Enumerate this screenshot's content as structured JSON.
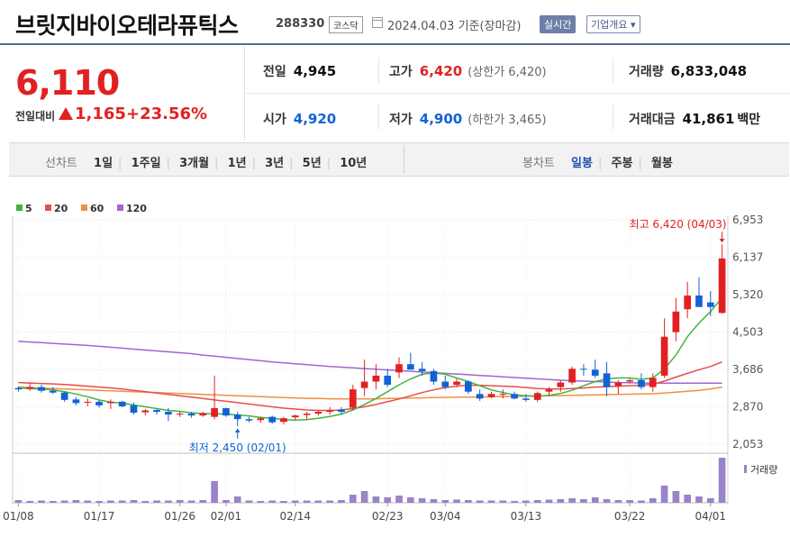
{
  "header": {
    "name": "브릿지바이오테라퓨틱스",
    "code": "288330",
    "market": "코스닥",
    "as_of": "2024.04.03 기준(장마감)",
    "realtime_btn": "실시간",
    "company_btn": "기업개요 ▾"
  },
  "quote": {
    "price": "6,110",
    "change_label": "전일대비",
    "change": "1,165",
    "change_pct": "+23.56%",
    "prev_close_label": "전일",
    "prev_close": "4,945",
    "high_label": "고가",
    "high": "6,420",
    "upper_limit": "(상한가 6,420)",
    "volume_label": "거래량",
    "volume": "6,833,048",
    "open_label": "시가",
    "open": "4,920",
    "low_label": "저가",
    "low": "4,900",
    "lower_limit": "(하한가 3,465)",
    "amount_label": "거래대금",
    "amount": "41,861",
    "amount_unit": "백만"
  },
  "toolbar": {
    "line_chart_label": "선차트",
    "periods": [
      "1일",
      "1주일",
      "3개월",
      "1년",
      "3년",
      "5년",
      "10년"
    ],
    "candle_label": "봉차트",
    "candle_periods": [
      "일봉",
      "주봉",
      "월봉"
    ],
    "active_candle": 0
  },
  "colors": {
    "up": "#e12121",
    "down": "#1262d6",
    "ma5": "#3fb53f",
    "ma20": "#e84c4c",
    "ma60": "#f09040",
    "ma120": "#a066d0",
    "volume": "#9a83c8"
  },
  "chart_data": {
    "type": "candlestick",
    "legend": [
      "5",
      "20",
      "60",
      "120"
    ],
    "y_ticks": [
      2053,
      2870,
      3686,
      4503,
      5320,
      6137,
      6953
    ],
    "ylim": [
      2053,
      6953
    ],
    "x_labels": [
      {
        "label": "01/08",
        "index": 0
      },
      {
        "label": "01/17",
        "index": 7
      },
      {
        "label": "01/26",
        "index": 14
      },
      {
        "label": "02/01",
        "index": 18
      },
      {
        "label": "02/14",
        "index": 24
      },
      {
        "label": "02/23",
        "index": 32
      },
      {
        "label": "03/04",
        "index": 37
      },
      {
        "label": "03/13",
        "index": 44
      },
      {
        "label": "03/22",
        "index": 53
      },
      {
        "label": "04/01",
        "index": 60
      }
    ],
    "max_annotation": "최고 6,420 (04/03)",
    "min_annotation": "최저 2,450 (02/01)",
    "volume_label": "거래량",
    "candles": [
      [
        3280,
        3320,
        3200,
        3250
      ],
      [
        3260,
        3400,
        3220,
        3300
      ],
      [
        3300,
        3350,
        3180,
        3220
      ],
      [
        3220,
        3300,
        3150,
        3180
      ],
      [
        3180,
        3200,
        2980,
        3020
      ],
      [
        3030,
        3080,
        2900,
        2950
      ],
      [
        2960,
        3050,
        2880,
        2980
      ],
      [
        2980,
        3020,
        2850,
        2900
      ],
      [
        2950,
        3030,
        2820,
        2980
      ],
      [
        2980,
        3000,
        2860,
        2880
      ],
      [
        2900,
        2960,
        2700,
        2740
      ],
      [
        2750,
        2820,
        2680,
        2790
      ],
      [
        2800,
        2830,
        2700,
        2760
      ],
      [
        2760,
        2840,
        2560,
        2700
      ],
      [
        2700,
        2760,
        2650,
        2720
      ],
      [
        2720,
        2760,
        2630,
        2680
      ],
      [
        2680,
        2760,
        2650,
        2730
      ],
      [
        2650,
        3550,
        2600,
        2840
      ],
      [
        2840,
        2850,
        2650,
        2680
      ],
      [
        2700,
        2760,
        2450,
        2600
      ],
      [
        2600,
        2650,
        2530,
        2570
      ],
      [
        2580,
        2650,
        2520,
        2620
      ],
      [
        2650,
        2680,
        2500,
        2530
      ],
      [
        2540,
        2650,
        2480,
        2620
      ],
      [
        2640,
        2700,
        2580,
        2680
      ],
      [
        2690,
        2760,
        2600,
        2720
      ],
      [
        2720,
        2800,
        2680,
        2760
      ],
      [
        2760,
        2860,
        2700,
        2790
      ],
      [
        2810,
        2860,
        2720,
        2760
      ],
      [
        2850,
        3350,
        2800,
        3250
      ],
      [
        3280,
        3900,
        3100,
        3420
      ],
      [
        3420,
        3800,
        3250,
        3550
      ],
      [
        3550,
        3700,
        3300,
        3350
      ],
      [
        3620,
        3950,
        3500,
        3800
      ],
      [
        3800,
        4050,
        3680,
        3680
      ],
      [
        3700,
        3850,
        3550,
        3650
      ],
      [
        3650,
        3700,
        3350,
        3420
      ],
      [
        3420,
        3550,
        3250,
        3300
      ],
      [
        3350,
        3480,
        3300,
        3420
      ],
      [
        3420,
        3450,
        3150,
        3200
      ],
      [
        3150,
        3250,
        3000,
        3050
      ],
      [
        3080,
        3200,
        3050,
        3150
      ],
      [
        3150,
        3250,
        3050,
        3150
      ],
      [
        3150,
        3200,
        3030,
        3050
      ],
      [
        3050,
        3150,
        2980,
        3020
      ],
      [
        3020,
        3200,
        2980,
        3170
      ],
      [
        3200,
        3300,
        3120,
        3250
      ],
      [
        3300,
        3450,
        3200,
        3400
      ],
      [
        3400,
        3750,
        3350,
        3700
      ],
      [
        3700,
        3800,
        3550,
        3680
      ],
      [
        3680,
        3900,
        3500,
        3550
      ],
      [
        3600,
        3850,
        3100,
        3300
      ],
      [
        3320,
        3450,
        3150,
        3400
      ],
      [
        3420,
        3500,
        3380,
        3450
      ],
      [
        3450,
        3600,
        3250,
        3300
      ],
      [
        3300,
        3600,
        3200,
        3500
      ],
      [
        3550,
        4800,
        3500,
        4400
      ],
      [
        4500,
        5250,
        4300,
        4950
      ],
      [
        5000,
        5600,
        4800,
        5300
      ],
      [
        5300,
        5700,
        5050,
        5050
      ],
      [
        5150,
        5400,
        4850,
        5050
      ],
      [
        4920,
        6420,
        4900,
        6110
      ]
    ],
    "volumes": [
      0,
      0,
      0,
      0,
      0,
      0,
      0,
      0,
      0,
      0,
      0,
      0,
      0,
      0,
      0,
      0,
      0,
      0,
      0,
      0,
      0,
      0,
      0,
      0,
      0,
      0,
      0,
      0,
      0,
      0,
      0,
      0,
      0,
      0,
      0,
      0,
      0,
      0,
      0,
      0,
      0,
      0,
      0,
      0,
      0,
      0,
      0,
      0,
      0,
      0,
      0,
      0,
      0,
      0,
      0,
      0,
      0,
      0,
      0,
      0,
      0,
      0
    ],
    "volume_relative": [
      0.06,
      0.04,
      0.05,
      0.04,
      0.05,
      0.06,
      0.05,
      0.04,
      0.05,
      0.05,
      0.06,
      0.04,
      0.05,
      0.05,
      0.06,
      0.05,
      0.06,
      0.48,
      0.06,
      0.14,
      0.05,
      0.04,
      0.05,
      0.04,
      0.05,
      0.05,
      0.05,
      0.05,
      0.06,
      0.18,
      0.26,
      0.14,
      0.12,
      0.16,
      0.12,
      0.1,
      0.08,
      0.06,
      0.07,
      0.06,
      0.05,
      0.05,
      0.05,
      0.04,
      0.05,
      0.06,
      0.07,
      0.08,
      0.1,
      0.08,
      0.12,
      0.08,
      0.06,
      0.06,
      0.05,
      0.1,
      0.38,
      0.26,
      0.18,
      0.14,
      0.1,
      1.0
    ],
    "ma5": [
      3280,
      3270,
      3255,
      3240,
      3200,
      3150,
      3090,
      3020,
      2970,
      2950,
      2910,
      2870,
      2830,
      2790,
      2770,
      2740,
      2720,
      2720,
      2710,
      2690,
      2670,
      2640,
      2620,
      2590,
      2580,
      2590,
      2620,
      2660,
      2710,
      2800,
      2920,
      3050,
      3200,
      3350,
      3480,
      3580,
      3610,
      3580,
      3500,
      3420,
      3330,
      3240,
      3180,
      3130,
      3110,
      3100,
      3120,
      3160,
      3230,
      3330,
      3420,
      3480,
      3500,
      3500,
      3470,
      3500,
      3700,
      4000,
      4400,
      4700,
      4950,
      5250
    ],
    "ma20": [
      3400,
      3390,
      3380,
      3370,
      3355,
      3340,
      3320,
      3300,
      3280,
      3260,
      3230,
      3200,
      3170,
      3140,
      3110,
      3080,
      3050,
      3020,
      2990,
      2960,
      2930,
      2900,
      2870,
      2840,
      2820,
      2800,
      2790,
      2790,
      2800,
      2830,
      2870,
      2920,
      2980,
      3040,
      3110,
      3180,
      3240,
      3290,
      3320,
      3340,
      3340,
      3330,
      3320,
      3310,
      3290,
      3270,
      3260,
      3260,
      3270,
      3280,
      3300,
      3310,
      3320,
      3330,
      3340,
      3360,
      3430,
      3520,
      3600,
      3680,
      3750,
      3850
    ],
    "ma60": [
      3300,
      3290,
      3280,
      3270,
      3260,
      3250,
      3240,
      3230,
      3220,
      3210,
      3200,
      3190,
      3180,
      3170,
      3160,
      3150,
      3140,
      3130,
      3120,
      3110,
      3100,
      3090,
      3080,
      3070,
      3060,
      3055,
      3050,
      3045,
      3040,
      3040,
      3040,
      3045,
      3050,
      3055,
      3060,
      3065,
      3070,
      3075,
      3080,
      3080,
      3085,
      3090,
      3090,
      3095,
      3100,
      3105,
      3110,
      3115,
      3120,
      3125,
      3130,
      3135,
      3140,
      3145,
      3150,
      3155,
      3170,
      3190,
      3210,
      3230,
      3260,
      3300
    ],
    "ma120": [
      4300,
      4285,
      4270,
      4255,
      4240,
      4225,
      4210,
      4190,
      4170,
      4150,
      4130,
      4110,
      4090,
      4070,
      4050,
      4030,
      4000,
      3975,
      3950,
      3925,
      3900,
      3875,
      3850,
      3830,
      3810,
      3790,
      3770,
      3750,
      3735,
      3720,
      3705,
      3690,
      3675,
      3660,
      3645,
      3630,
      3615,
      3600,
      3585,
      3570,
      3555,
      3540,
      3525,
      3510,
      3495,
      3480,
      3465,
      3450,
      3440,
      3430,
      3420,
      3410,
      3400,
      3395,
      3390,
      3385,
      3385,
      3385,
      3385,
      3385,
      3385,
      3385
    ]
  }
}
